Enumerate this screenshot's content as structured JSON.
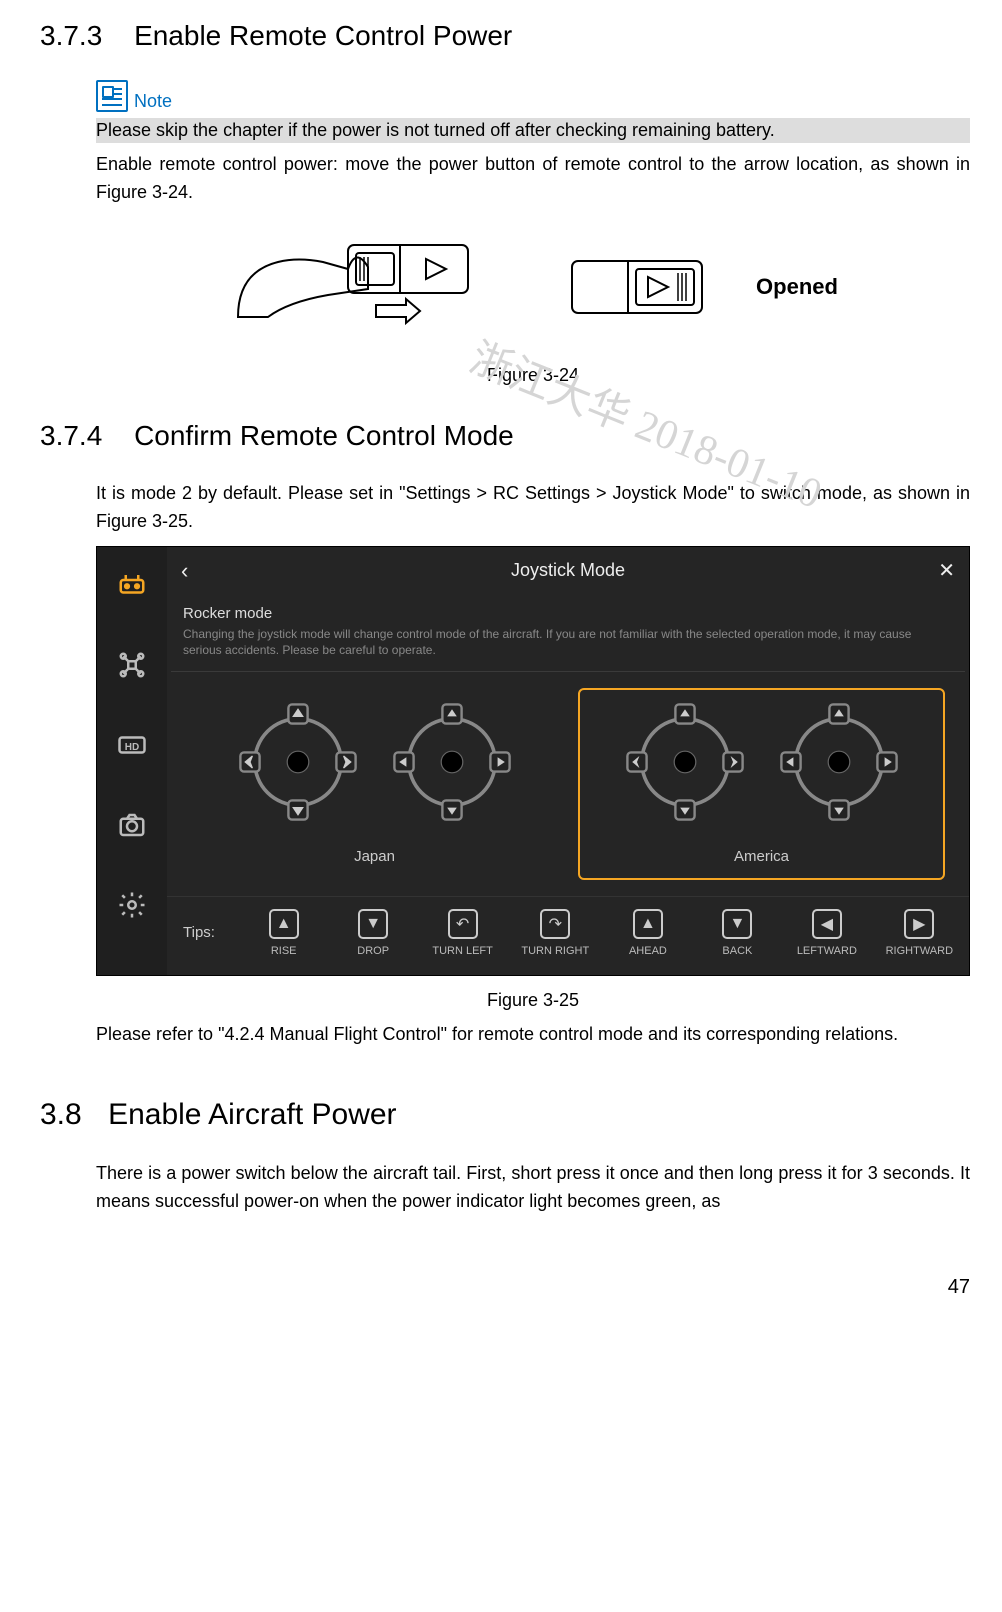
{
  "sections": {
    "s373": {
      "number": "3.7.3",
      "title": "Enable Remote Control Power"
    },
    "s374": {
      "number": "3.7.4",
      "title": "Confirm Remote Control Mode"
    },
    "s38": {
      "number": "3.8",
      "title": "Enable Aircraft Power"
    }
  },
  "note": {
    "label": "Note"
  },
  "texts": {
    "skip": "Please skip the chapter if the power is not turned off after checking remaining battery.",
    "enable_remote": "Enable remote control power: move the power button of remote control to the arrow location, as shown in Figure 3-24.",
    "opened": "Opened",
    "fig324": "Figure 3-24",
    "mode_intro": "It is mode 2 by default. Please set in \"Settings > RC Settings > Joystick Mode\" to switch mode, as shown in Figure 3-25.",
    "fig325": "Figure 3-25",
    "refer": "Please refer to \"4.2.4 Manual Flight Control\" for remote control mode and its corresponding relations.",
    "aircraft": "There is a power switch below the aircraft tail. First, short press it once and then long press it for 3 seconds. It means successful power-on when the power indicator light becomes green, as"
  },
  "app": {
    "header": {
      "title": "Joystick Mode"
    },
    "rocker": {
      "title": "Rocker mode",
      "desc": "Changing the joystick mode will change control mode of the aircraft. If you are not familiar with the selected operation mode, it may cause serious accidents. Please be careful to operate."
    },
    "modes": {
      "japan": "Japan",
      "america": "America"
    },
    "tips": {
      "label": "Tips:",
      "items": [
        "RISE",
        "DROP",
        "TURN LEFT",
        "TURN RIGHT",
        "AHEAD",
        "BACK",
        "LEFTWARD",
        "RIGHTWARD"
      ]
    }
  },
  "watermark": "浙江大华 2018-01-10",
  "page_number": "47"
}
